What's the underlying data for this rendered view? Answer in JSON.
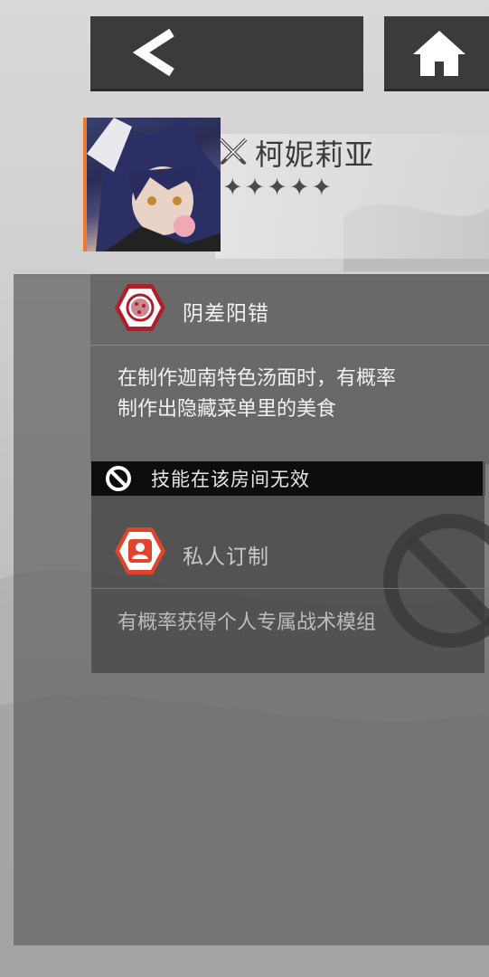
{
  "nav": {
    "back_icon": "chevron-left-icon",
    "home_icon": "home-icon"
  },
  "operator": {
    "name": "柯妮莉亚",
    "class_icon": "crossed-swords-icon",
    "rarity_stars": 5,
    "accent_color": "#f07a2a"
  },
  "skills": [
    {
      "icon": "pizza-badge-icon",
      "title": "阴差阳错",
      "description_line1": "在制作迦南特色汤面时，有概率",
      "description_line2": "制作出隐藏菜单里的美食",
      "active": true
    },
    {
      "icon": "portrait-badge-icon",
      "title": "私人订制",
      "description": "有概率获得个人专属战术模组",
      "active": false
    }
  ],
  "invalid_notice": {
    "icon": "prohibited-icon",
    "text": "技能在该房间无效"
  },
  "colors": {
    "active_badge_border": "#b01e2a",
    "inactive_badge": "#e0442c",
    "panel": "#5f5f5f"
  }
}
